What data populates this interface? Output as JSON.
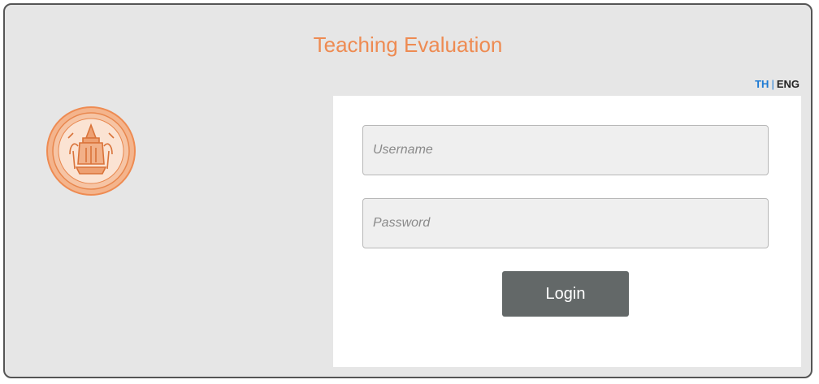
{
  "header": {
    "title": "Teaching Evaluation"
  },
  "language": {
    "th_label": "TH",
    "separator": "|",
    "eng_label": "ENG",
    "active": "TH"
  },
  "logo": {
    "icon": "university-seal-icon",
    "color": "#ee8b52"
  },
  "form": {
    "username_placeholder": "Username",
    "username_value": "",
    "password_placeholder": "Password",
    "password_value": "",
    "login_label": "Login"
  },
  "colors": {
    "accent": "#ee8b52",
    "link": "#1e7bd4",
    "button": "#636868",
    "background": "#e6e6e6"
  }
}
